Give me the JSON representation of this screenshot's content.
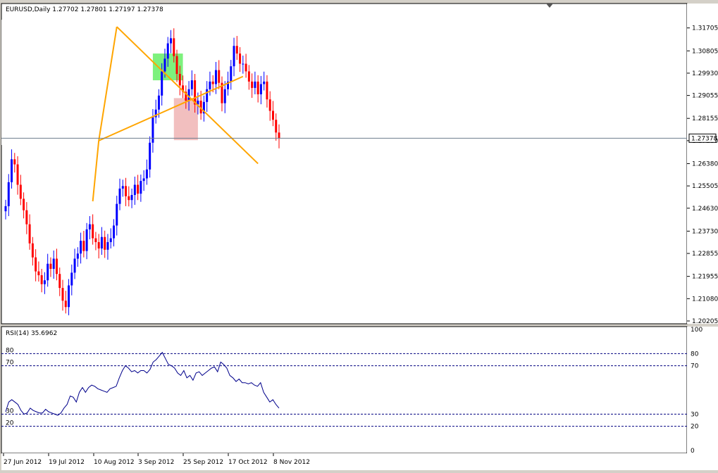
{
  "chart_data": [
    {
      "type": "candlestick",
      "symbol_line": "EURUSD,Daily  1.27702 1.27801 1.27197 1.27378",
      "current_price_label": "1.27378",
      "current_price": 1.27378,
      "ylim": [
        1.20205,
        1.3258
      ],
      "y_ticks": [
        "1.31705",
        "1.30805",
        "1.29930",
        "1.29055",
        "1.28155",
        "1.27280",
        "1.26380",
        "1.25505",
        "1.24630",
        "1.23730",
        "1.22855",
        "1.21955",
        "1.21080",
        "1.20205"
      ],
      "x_tick_labels": [
        "27 Jun 2012",
        "19 Jul 2012",
        "10 Aug 2012",
        "3 Sep 2012",
        "25 Sep 2012",
        "17 Oct 2012",
        "8 Nov 2012"
      ],
      "colors": {
        "bull": "#0000ff",
        "bear": "#ff0000",
        "trendline": "#ffa500",
        "bull_zone": "#66ee66",
        "bear_zone": "#f0b4b4",
        "price_line": "#6d7b8d"
      },
      "candles_close": [
        1.2471,
        1.2565,
        1.2655,
        1.2635,
        1.2555,
        1.25,
        1.2455,
        1.24,
        1.2325,
        1.227,
        1.2215,
        1.22,
        1.2165,
        1.218,
        1.2245,
        1.2225,
        1.2265,
        1.2205,
        1.215,
        1.21,
        1.2075,
        1.216,
        1.221,
        1.2265,
        1.2285,
        1.2335,
        1.2295,
        1.238,
        1.24,
        1.2345,
        1.233,
        1.2305,
        1.235,
        1.23,
        1.233,
        1.2345,
        1.2395,
        1.248,
        1.254,
        1.255,
        1.251,
        1.2495,
        1.2515,
        1.2555,
        1.252,
        1.257,
        1.258,
        1.2615,
        1.272,
        1.282,
        1.285,
        1.2905,
        1.3,
        1.305,
        1.311,
        1.313,
        1.306,
        1.299,
        1.2945,
        1.292,
        1.2885,
        1.293,
        1.2965,
        1.287,
        1.2885,
        1.2835,
        1.288,
        1.293,
        1.296,
        1.295,
        1.3005,
        1.2955,
        1.2875,
        1.293,
        1.296,
        1.302,
        1.31,
        1.307,
        1.303,
        1.303,
        1.3,
        1.296,
        1.2935,
        1.296,
        1.291,
        1.295,
        1.296,
        1.289,
        1.2845,
        1.281,
        1.276,
        1.2737
      ],
      "trendlines": [
        {
          "name": "upper",
          "from": [
            31,
            1.2728
          ],
          "to": [
            37,
            1.3175
          ]
        },
        {
          "name": "descending",
          "from": [
            37,
            1.3175
          ],
          "to": [
            84,
            1.2638
          ]
        },
        {
          "name": "ascending",
          "from": [
            31,
            1.2728
          ],
          "to": [
            79,
            1.298
          ]
        },
        {
          "name": "left-leg",
          "from": [
            29,
            1.249
          ],
          "to": [
            31,
            1.2728
          ]
        }
      ],
      "zones": [
        {
          "name": "bull-zone",
          "from_index": 49,
          "to_index": 59,
          "low": 1.2965,
          "high": 1.307
        },
        {
          "name": "bear-zone",
          "from_index": 56,
          "to_index": 64,
          "low": 1.273,
          "high": 1.2895
        }
      ]
    },
    {
      "type": "line",
      "indicator_label": "RSI(14) 35.6962",
      "ylim": [
        0,
        100
      ],
      "y_ticks": [
        "100",
        "80",
        "70",
        "30",
        "20",
        "0"
      ],
      "levels": [
        "80",
        "70",
        "30",
        "20"
      ],
      "values": [
        32,
        40,
        42,
        40,
        38,
        33,
        30,
        31,
        35,
        33,
        32,
        31,
        31,
        34,
        32,
        31,
        30,
        29,
        31,
        35,
        38,
        45,
        44,
        40,
        48,
        52,
        48,
        52,
        54,
        53,
        51,
        50,
        49,
        48,
        51,
        52,
        53,
        60,
        66,
        70,
        68,
        65,
        66,
        64,
        66,
        66,
        64,
        67,
        73,
        75,
        78,
        81,
        76,
        71,
        70,
        68,
        64,
        62,
        66,
        60,
        62,
        58,
        64,
        65,
        62,
        64,
        66,
        68,
        69,
        65,
        73,
        71,
        68,
        62,
        60,
        57,
        59,
        56,
        56,
        55,
        56,
        54,
        53,
        56,
        48,
        44,
        40,
        42,
        38,
        35
      ]
    }
  ]
}
